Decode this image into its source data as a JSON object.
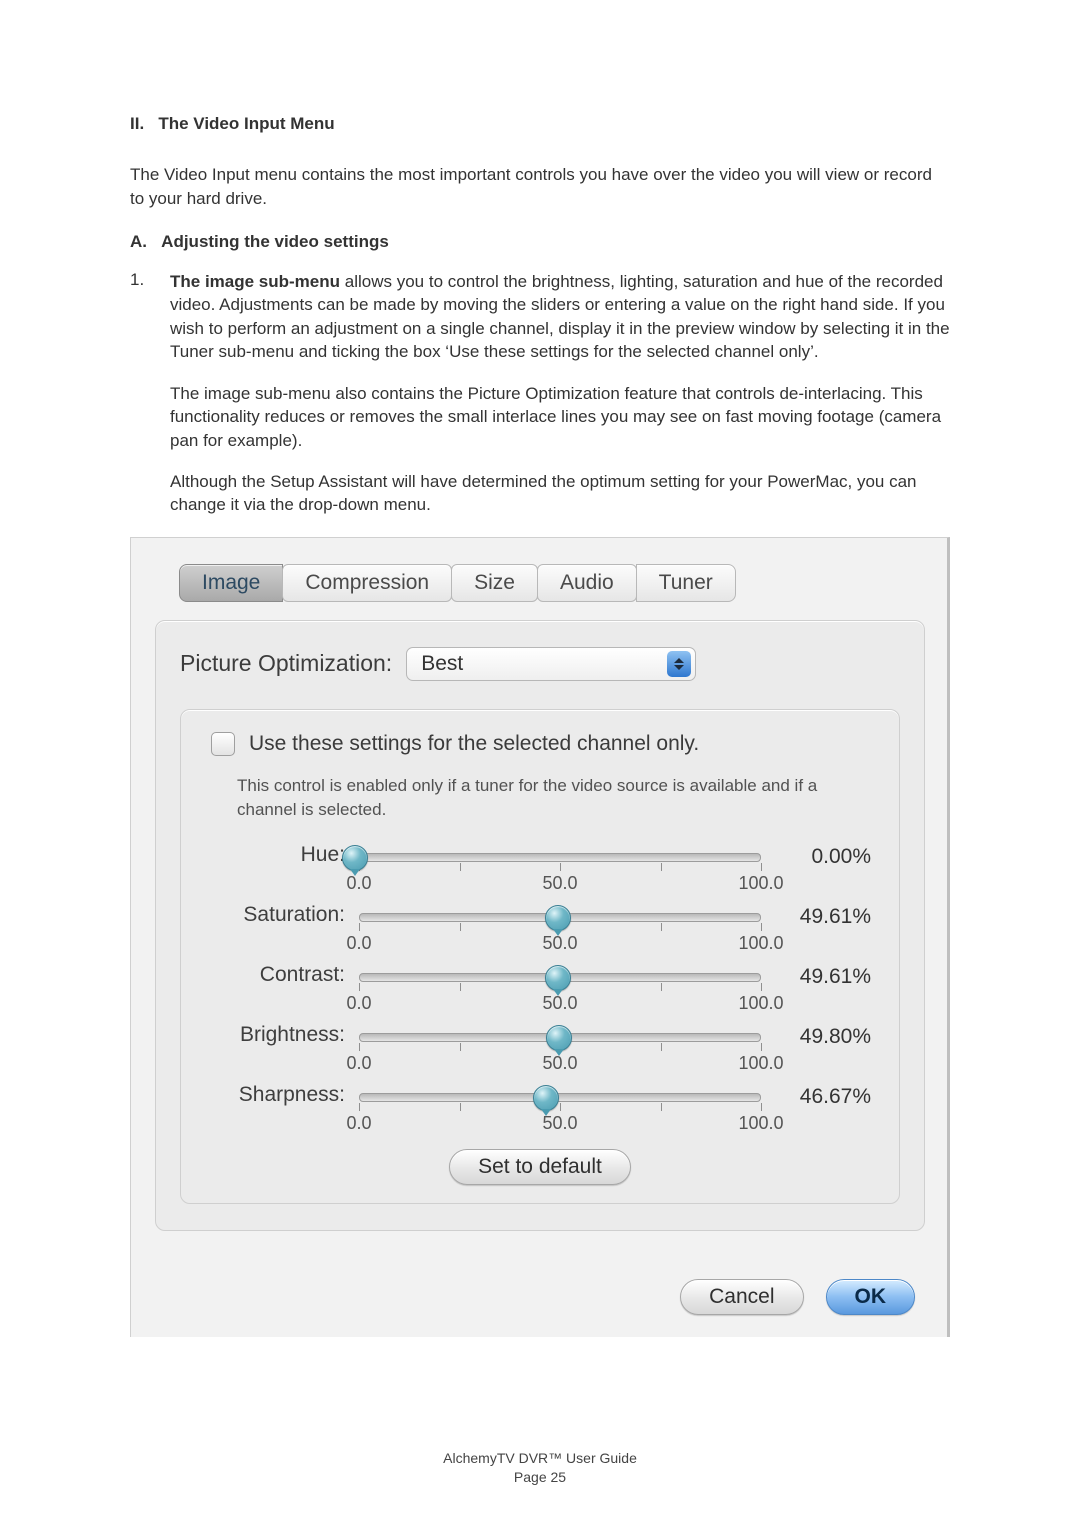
{
  "section": {
    "num": "II.",
    "title": "The Video Input Menu",
    "intro": "The Video Input menu contains the most important controls you have over the video you will view or record to your hard drive."
  },
  "subA": {
    "num": "A.",
    "title": "Adjusting the video settings"
  },
  "item1": {
    "num": "1.",
    "bold": "The image sub-menu",
    "rest1": " allows you to control the brightness, lighting, saturation and hue of the recorded video. Adjustments can be made by moving the sliders or entering a value on the right hand side. If you wish to perform an adjustment on a single channel, display it in the preview window by selecting it in the Tuner sub-menu and ticking the box ‘Use these settings for the selected channel only’.",
    "para2": "The image sub-menu also contains the Picture Optimization feature that controls de-interlacing. This functionality reduces or removes the small interlace lines you may see on fast moving footage (camera pan for example).",
    "para3": "Although the Setup Assistant will have determined the optimum setting for your PowerMac, you can change it via the drop-down menu."
  },
  "tabs": [
    "Image",
    "Compression",
    "Size",
    "Audio",
    "Tuner"
  ],
  "activeTabIndex": 0,
  "pictureOptimization": {
    "label": "Picture Optimization:",
    "value": "Best"
  },
  "channelOnly": {
    "checked": false,
    "label": "Use these settings for the selected channel only.",
    "hint": "This control is enabled only if a tuner for the video source is available and if a channel is selected."
  },
  "sliders": [
    {
      "name": "Hue:",
      "min": "0.0",
      "mid": "50.0",
      "max": "100.0",
      "value": "0.00%",
      "pos": 0.0
    },
    {
      "name": "Saturation:",
      "min": "0.0",
      "mid": "50.0",
      "max": "100.0",
      "value": "49.61%",
      "pos": 0.4961
    },
    {
      "name": "Contrast:",
      "min": "0.0",
      "mid": "50.0",
      "max": "100.0",
      "value": "49.61%",
      "pos": 0.4961
    },
    {
      "name": "Brightness:",
      "min": "0.0",
      "mid": "50.0",
      "max": "100.0",
      "value": "49.80%",
      "pos": 0.498
    },
    {
      "name": "Sharpness:",
      "min": "0.0",
      "mid": "50.0",
      "max": "100.0",
      "value": "46.67%",
      "pos": 0.4667
    }
  ],
  "buttons": {
    "setDefault": "Set to default",
    "cancel": "Cancel",
    "ok": "OK"
  },
  "footer": {
    "line1": "AlchemyTV DVR™ User Guide",
    "line2a": "Page ",
    "line2b": "25"
  }
}
